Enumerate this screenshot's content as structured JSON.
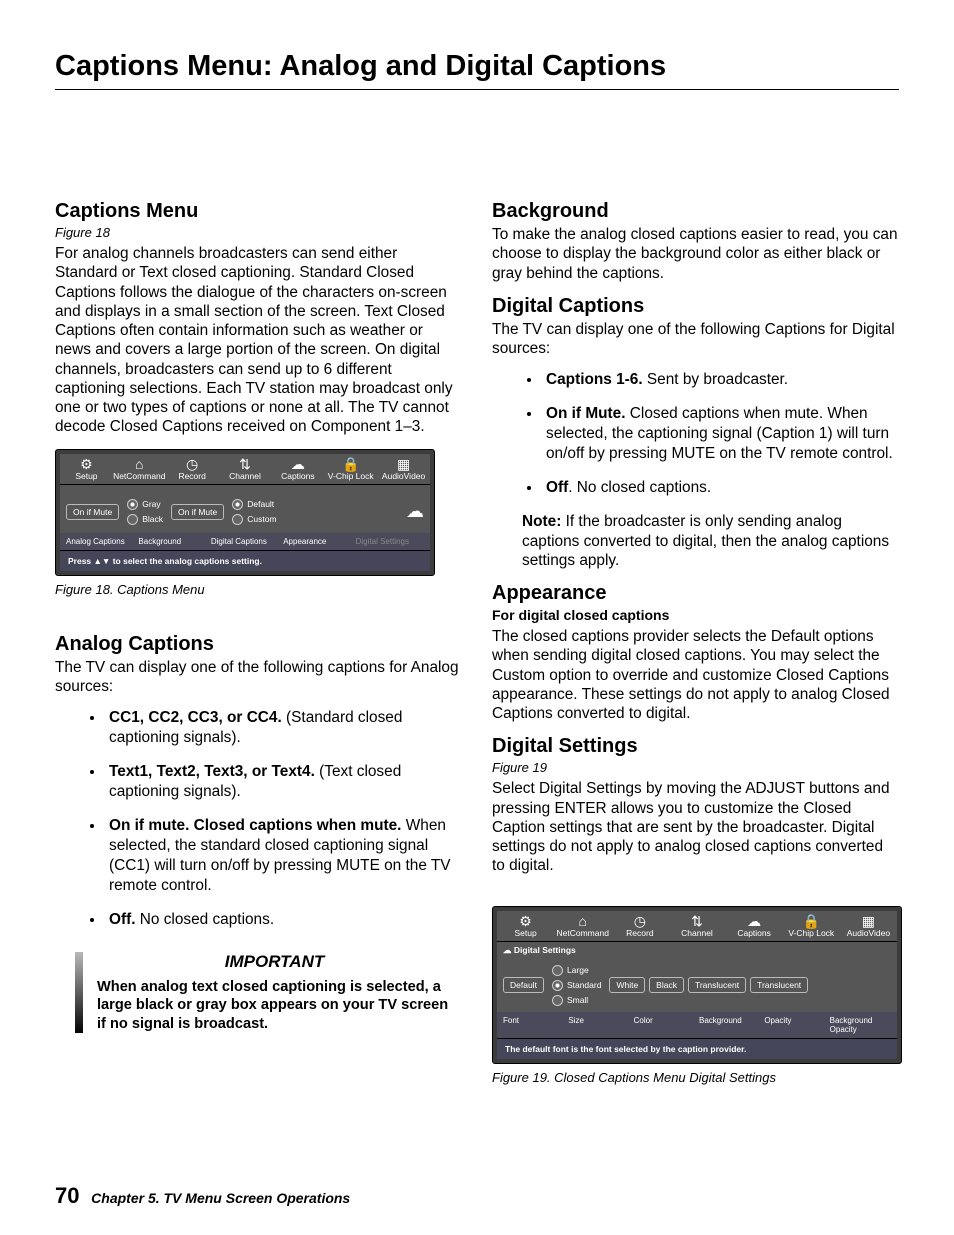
{
  "title": "Captions Menu: Analog and Digital Captions",
  "left": {
    "h_captions_menu": "Captions Menu",
    "fig18_ref": "Figure 18",
    "captions_menu_body": "For analog channels broadcasters can send either Standard or Text closed captioning.  Standard Closed Captions follows the dialogue of the characters on-screen and displays in a small section of the screen.  Text Closed Captions often contain information such as weather or news and covers a large portion of the screen.  On digital channels, broadcasters can send up to 6 different captioning selections.   Each TV station may broadcast only one or two types of captions or none at all.  The TV cannot decode Closed Captions received on Component 1–3.",
    "fig18_cap": "Figure 18. Captions Menu",
    "h_analog": "Analog Captions",
    "analog_intro": "The TV can display one of the following captions for Analog sources:",
    "analog_items": [
      {
        "b": "CC1, CC2, CC3, or CC4.",
        "rest": " (Standard closed captioning signals)."
      },
      {
        "b": "Text1, Text2, Text3, or Text4.",
        "rest": " (Text closed captioning signals)."
      },
      {
        "b": "On if mute.  Closed captions when mute.",
        "rest": "  When selected, the standard closed captioning signal (CC1) will turn on/off by pressing MUTE on the TV remote control."
      },
      {
        "b": "Off.",
        "rest": " No closed captions."
      }
    ],
    "imp_title": "IMPORTANT",
    "imp_body": "When analog text closed captioning is selected, a large black or gray box appears on your TV screen if no signal is broadcast."
  },
  "right": {
    "h_bg": "Background",
    "bg_body": "To make the analog closed captions easier to read, you can choose to display the background color as either black or gray behind the captions.",
    "h_dig": "Digital Captions",
    "dig_intro": "The TV can display one of the following Captions for Digital sources:",
    "dig_items": [
      {
        "b": "Captions 1-6.",
        "rest": "  Sent by broadcaster."
      },
      {
        "b": "On if Mute.",
        "rest": "  Closed captions when mute.  When selected, the captioning signal (Caption 1) will turn on/off by pressing MUTE on the TV remote control."
      },
      {
        "b": "Off",
        "rest": ". No closed captions."
      }
    ],
    "dig_note_b": "Note:",
    "dig_note_rest": "  If the broadcaster is only sending analog captions converted to digital, then the analog captions settings apply.",
    "h_app": "Appearance",
    "app_sub": "For digital closed captions",
    "app_body": "The closed captions provider selects the Default options when sending digital closed captions.  You may select the Custom option to override and customize Closed Captions appearance.  These settings do not apply to analog Closed Captions converted to digital.",
    "h_ds": "Digital Settings",
    "fig19_ref": "Figure 19",
    "ds_body": "Select Digital Settings by moving the ADJUST buttons and pressing ENTER allows you to customize the Closed Caption settings that are sent by the broadcaster.  Digital settings do not apply to analog closed captions converted to digital.",
    "fig19_cap": "Figure 19. Closed Captions Menu Digital Settings"
  },
  "menu": {
    "tabs": [
      "Setup",
      "NetCommand",
      "Record",
      "Channel",
      "Captions",
      "V-Chip Lock",
      "AudioVideo"
    ],
    "fig18": {
      "analog_value": "On if Mute",
      "bg_gray": "Gray",
      "bg_black": "Black",
      "dc_value": "On if Mute",
      "app_default": "Default",
      "app_custom": "Custom",
      "labels": [
        "Analog Captions",
        "Background",
        "Digital Captions",
        "Appearance",
        "Digital Settings"
      ],
      "hint": "Press ▲▼ to select the analog captions setting."
    },
    "fig19": {
      "crumb": "Digital Settings",
      "size_large": "Large",
      "size_std": "Standard",
      "size_small": "Small",
      "font": "Default",
      "color": "White",
      "bg": "Black",
      "opacity": "Translucent",
      "bgop": "Translucent",
      "labels": [
        "Font",
        "Size",
        "Color",
        "Background",
        "Opacity",
        "Background Opacity"
      ],
      "hint": "The default font is the font selected by the caption provider."
    }
  },
  "footer": {
    "page": "70",
    "chapter": "Chapter 5. TV Menu Screen Operations"
  }
}
